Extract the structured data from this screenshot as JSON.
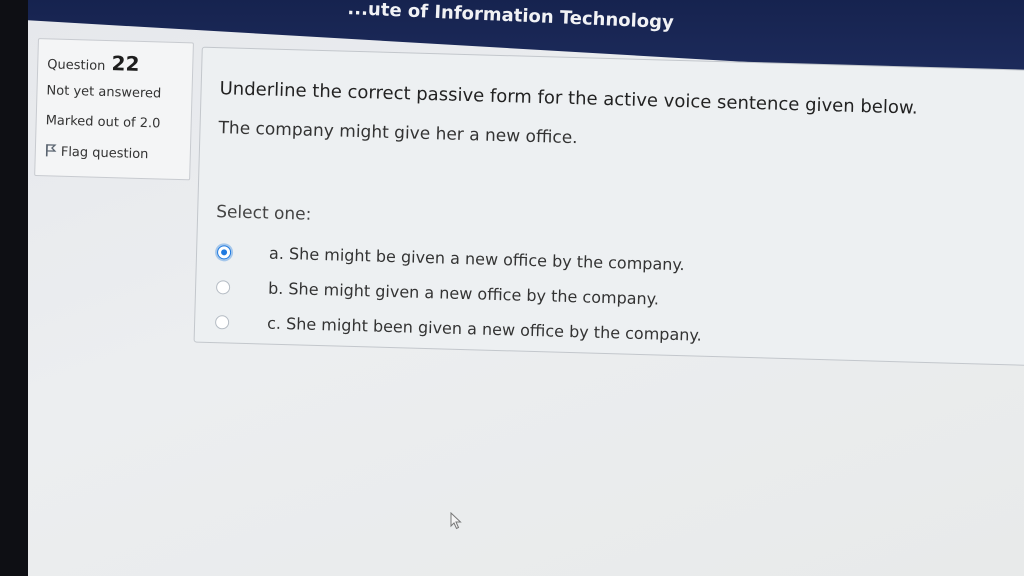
{
  "header": {
    "title": "...ute of Information Technology"
  },
  "question_info": {
    "label": "Question",
    "number": "22",
    "state": "Not yet answered",
    "grade": "Marked out of 2.0",
    "flag_label": "Flag question",
    "flag_icon": "flag-icon"
  },
  "question": {
    "text": "Underline the correct passive form for the active voice sentence given below.",
    "sentence": "The company might give her a new office.",
    "prompt": "Select one:",
    "selected_index": 0,
    "options": [
      {
        "label": "a. She might be given a new office by the company."
      },
      {
        "label": "b. She might given a new office by the company."
      },
      {
        "label": "c. She might been given a new office by the company."
      }
    ]
  },
  "colors": {
    "header_bg": "#16234f",
    "radio_selected": "#1f7ae0"
  }
}
